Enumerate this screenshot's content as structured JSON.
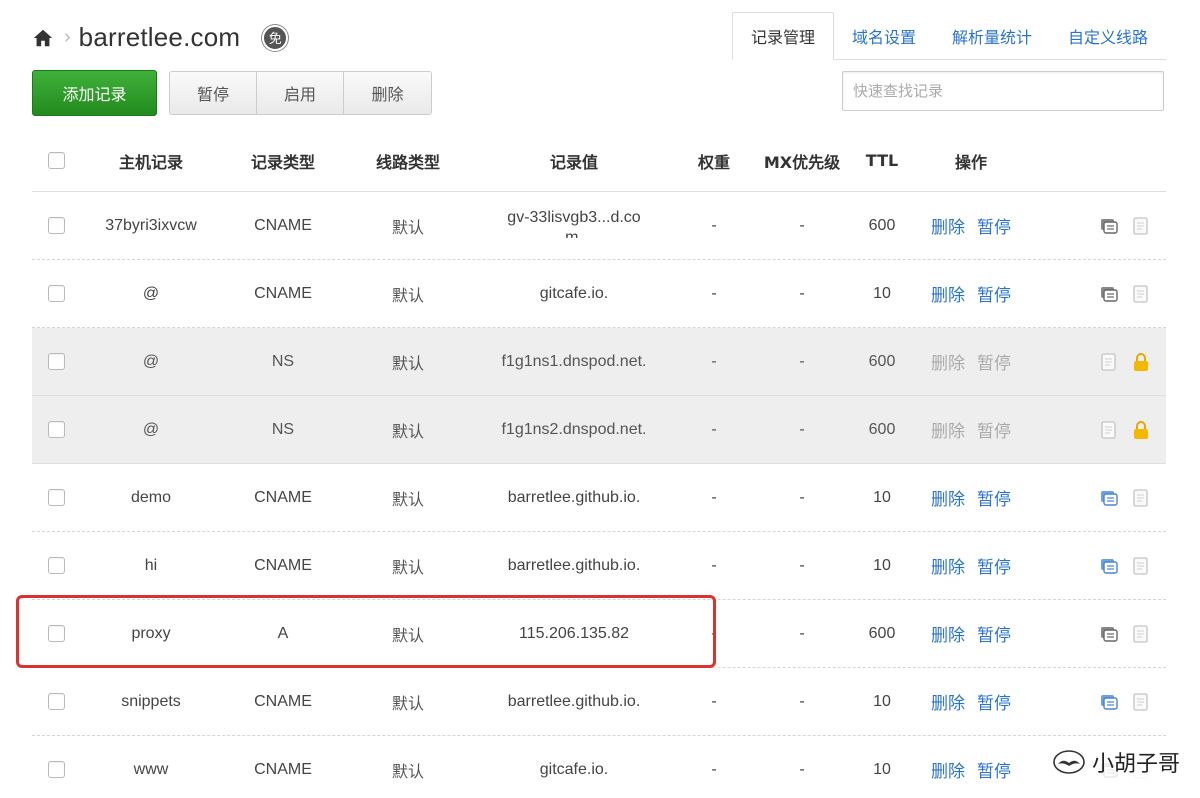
{
  "header": {
    "domain": "barretlee.com",
    "breadcrumb_sep": "›",
    "badge": "免",
    "tabs": [
      {
        "label": "记录管理",
        "active": true
      },
      {
        "label": "域名设置",
        "active": false
      },
      {
        "label": "解析量统计",
        "active": false
      },
      {
        "label": "自定义线路",
        "active": false
      }
    ]
  },
  "toolbar": {
    "add_label": "添加记录",
    "pause_label": "暂停",
    "enable_label": "启用",
    "delete_label": "删除",
    "search_placeholder": "快速查找记录"
  },
  "table": {
    "columns": [
      "主机记录",
      "记录类型",
      "线路类型",
      "记录值",
      "权重",
      "MX优先级",
      "TTL",
      "操作"
    ],
    "rows": [
      {
        "host": "37byri3ixvcw",
        "type": "CNAME",
        "line": "默认",
        "value": "gv-33lisvgb3...d.com.",
        "weight": "-",
        "mx": "-",
        "ttl": "600",
        "op_delete": "删除",
        "op_pause": "暂停",
        "locked": false
      },
      {
        "host": "@",
        "type": "CNAME",
        "line": "默认",
        "value": "gitcafe.io.",
        "weight": "-",
        "mx": "-",
        "ttl": "10",
        "op_delete": "删除",
        "op_pause": "暂停",
        "locked": false
      },
      {
        "host": "@",
        "type": "NS",
        "line": "默认",
        "value": "f1g1ns1.dnspod.net.",
        "weight": "-",
        "mx": "-",
        "ttl": "600",
        "op_delete": "删除",
        "op_pause": "暂停",
        "locked": true
      },
      {
        "host": "@",
        "type": "NS",
        "line": "默认",
        "value": "f1g1ns2.dnspod.net.",
        "weight": "-",
        "mx": "-",
        "ttl": "600",
        "op_delete": "删除",
        "op_pause": "暂停",
        "locked": true
      },
      {
        "host": "demo",
        "type": "CNAME",
        "line": "默认",
        "value": "barretlee.github.io.",
        "weight": "-",
        "mx": "-",
        "ttl": "10",
        "op_delete": "删除",
        "op_pause": "暂停",
        "locked": false
      },
      {
        "host": "hi",
        "type": "CNAME",
        "line": "默认",
        "value": "barretlee.github.io.",
        "weight": "-",
        "mx": "-",
        "ttl": "10",
        "op_delete": "删除",
        "op_pause": "暂停",
        "locked": false
      },
      {
        "host": "proxy",
        "type": "A",
        "line": "默认",
        "value": "115.206.135.82",
        "weight": "-",
        "mx": "-",
        "ttl": "600",
        "op_delete": "删除",
        "op_pause": "暂停",
        "locked": false
      },
      {
        "host": "snippets",
        "type": "CNAME",
        "line": "默认",
        "value": "barretlee.github.io.",
        "weight": "-",
        "mx": "-",
        "ttl": "10",
        "op_delete": "删除",
        "op_pause": "暂停",
        "locked": false
      },
      {
        "host": "www",
        "type": "CNAME",
        "line": "默认",
        "value": "gitcafe.io.",
        "weight": "-",
        "mx": "-",
        "ttl": "10",
        "op_delete": "删除",
        "op_pause": "暂停",
        "locked": false
      }
    ]
  },
  "watermark": {
    "text": "小胡子哥"
  },
  "colors": {
    "accent": "#2a74c7",
    "add_button": "#2e9e2a",
    "highlight": "#d9322f",
    "locked_row": "#eeeeee",
    "lock": "#f0b400"
  }
}
